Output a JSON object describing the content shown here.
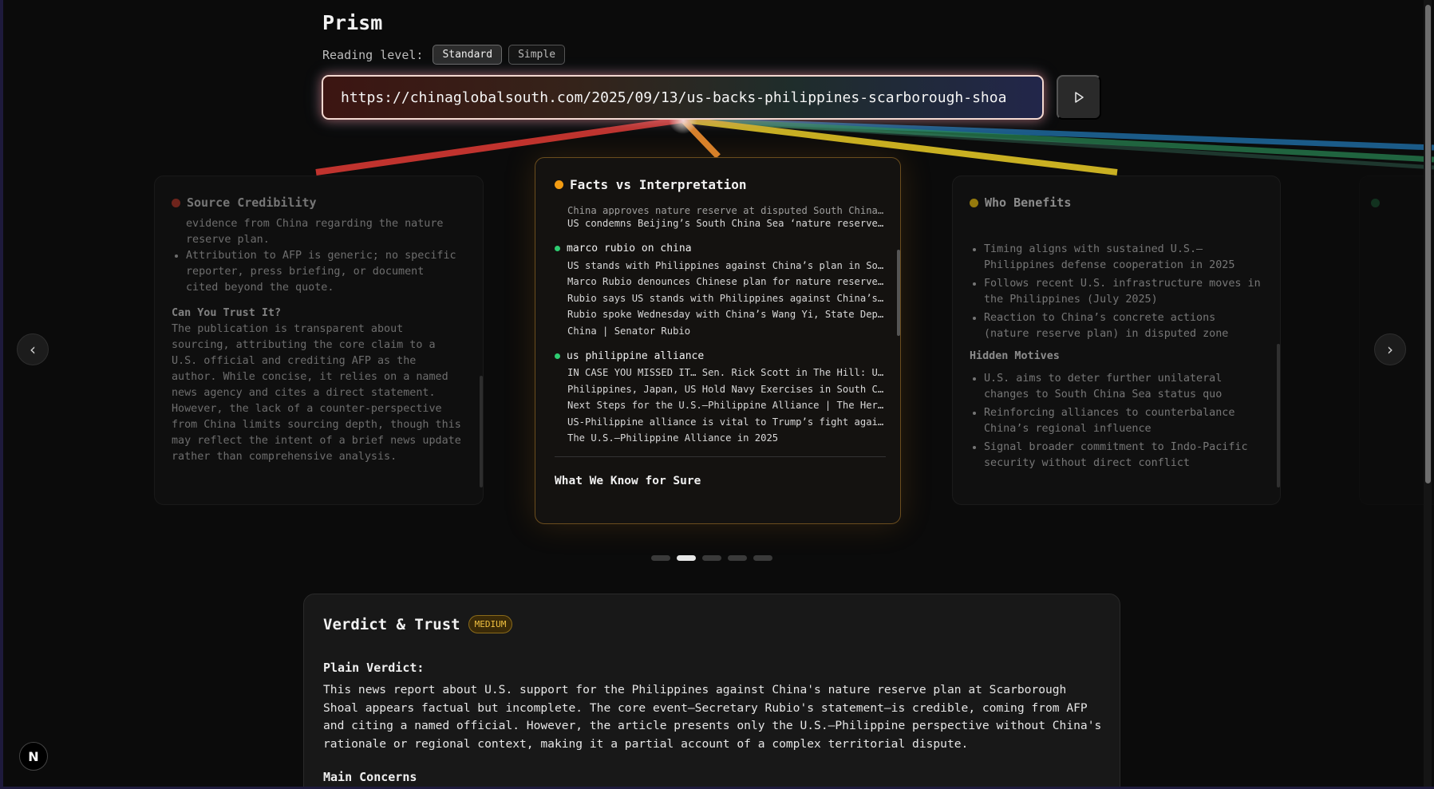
{
  "app": {
    "title": "Prism"
  },
  "reading_level": {
    "label": "Reading level:",
    "options": [
      "Standard",
      "Simple"
    ],
    "selected": "Standard"
  },
  "url_input": {
    "value": "https://chinaglobalsouth.com/2025/09/13/us-backs-philippines-scarborough-shoa"
  },
  "colors": {
    "credibility": "#c0392b",
    "facts": "#f39c12",
    "benefits": "#f1c40f",
    "topic": "#2ecc71",
    "badge": "#f0c040"
  },
  "cards": {
    "credibility": {
      "title": "Source Credibility",
      "partial_line": "evidence from China regarding the nature",
      "partial_line2": "reserve plan.",
      "bullets": [
        "Attribution to AFP is generic; no specific reporter, press briefing, or document cited beyond the quote."
      ],
      "trust_heading": "Can You Trust It?",
      "trust_text": "The publication is transparent about sourcing, attributing the core claim to a U.S. official and crediting AFP as the author. While concise, it relies on a named news agency and cites a direct statement. However, the lack of a counter-perspective from China limits sourcing depth, though this may reflect the intent of a brief news update rather than comprehensive analysis."
    },
    "facts": {
      "title": "Facts vs Interpretation",
      "top_lines": [
        "China approves nature reserve at disputed South China Sea shoal",
        "US condemns Beijing’s South China Sea ‘nature reserve’ plan"
      ],
      "topics": [
        {
          "name": "marco rubio on china",
          "lines": [
            "US stands with Philippines against China’s plan in South China Sea",
            "Marco Rubio denounces Chinese plan for nature reserve near disputed shoal",
            "Rubio says US stands with Philippines against China’s plan for shoal",
            "Rubio spoke Wednesday with China’s Wang Yi, State Department says",
            "China | Senator Rubio"
          ]
        },
        {
          "name": "us philippine alliance",
          "lines": [
            "IN CASE YOU MISSED IT… Sen. Rick Scott in The Hill: US-Philippine alliance",
            "Philippines, Japan, US Hold Navy Exercises in South China Sea",
            "Next Steps for the U.S.–Philippine Alliance | The Heritage Foundation",
            "US-Philippine alliance is vital to Trump’s fight against China",
            "The U.S.–Philippine Alliance in 2025"
          ]
        }
      ],
      "know_heading": "What We Know for Sure"
    },
    "benefits": {
      "title": "Who Benefits",
      "bullets": [
        "Timing aligns with sustained U.S.–Philippines defense cooperation in 2025",
        "Follows recent U.S. infrastructure moves in the Philippines (July 2025)",
        "Reaction to China’s concrete actions (nature reserve plan) in disputed zone"
      ],
      "hidden_heading": "Hidden Motives",
      "hidden_bullets": [
        "U.S. aims to deter further unilateral changes to South China Sea status quo",
        "Reinforcing alliances to counterbalance China’s regional influence",
        "Signal broader commitment to Indo-Pacific security without direct conflict"
      ]
    }
  },
  "nav": {
    "prev": "‹",
    "next": "›"
  },
  "pager": {
    "count": 5,
    "active_index": 1
  },
  "verdict": {
    "title": "Verdict & Trust",
    "badge": "MEDIUM",
    "plain_label": "Plain Verdict:",
    "plain_text": "This news report about U.S. support for the Philippines against China's nature reserve plan at Scarborough Shoal appears factual but incomplete. The core event—Secretary Rubio's statement—is credible, coming from AFP and citing a named official. However, the article presents only the U.S.–Philippine perspective without China's rationale or regional context, making it a partial account of a complex territorial dispute.",
    "concerns_label": "Main Concerns"
  },
  "logo": {
    "letter": "N"
  }
}
